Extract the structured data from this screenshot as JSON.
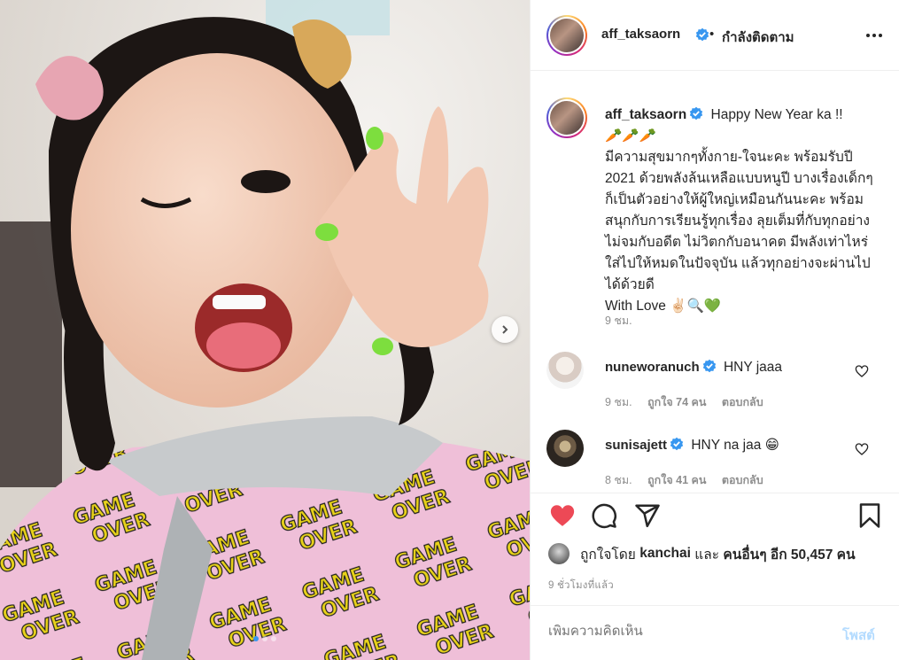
{
  "post": {
    "username": "aff_taksaorn",
    "separator": "•",
    "follow_label": "กำลังติดตาม",
    "caption_head": "Happy New Year ka !!",
    "caption_emoji_line": "🥕🥕🥕",
    "caption_body": "มีความสุขมากๆทั้งกาย-ใจนะคะ พร้อมรับปี 2021 ด้วยพลังล้นเหลือแบบหนูปี บางเรื่องเด็กๆก็เป็นตัวอย่างให้ผู้ใหญ่เหมือนกันนะคะ พร้อมสนุกกับการเรียนรู้ทุกเรื่อง ลุยเต็มที่กับทุกอย่าง ไม่จมกับอดีต ไม่วิตกกับอนาคต มีพลังเท่าไหร่ใส่ไปให้หมดในปัจจุบัน แล้วทุกอย่างจะผ่านไปได้ด้วยดี",
    "caption_tail": "With Love ✌🏻🔍💚",
    "caption_time": "9 ชม.",
    "carousel": {
      "count": 3,
      "active": 0
    }
  },
  "comments": [
    {
      "username": "nuneworanuch",
      "text": "HNY jaaa",
      "time": "9 ชม.",
      "likes": "ถูกใจ 74 คน",
      "reply": "ตอบกลับ"
    },
    {
      "username": "sunisajett",
      "text": "HNY na jaa 😁",
      "time": "8 ชม.",
      "likes": "ถูกใจ 41 คน",
      "reply": "ตอบกลับ"
    }
  ],
  "actions": {
    "liked_prefix": "ถูกใจโดย",
    "liked_user": "kanchai",
    "liked_and": "และ",
    "liked_others": "คนอื่นๆ อีก 50,457 คน",
    "ago": "9 ชั่วโมงที่แล้ว",
    "comment_placeholder": "เพิ่มความคิดเห็น",
    "post_label": "โพสต์"
  },
  "icons": {
    "verified": "verified-badge-icon",
    "more": "more-options-icon",
    "like": "heart-filled-icon",
    "comment": "comment-icon",
    "share": "share-icon",
    "save": "bookmark-icon",
    "next": "chevron-right-icon"
  },
  "colors": {
    "like_red": "#ed4956",
    "verified_blue": "#3897f0",
    "post_disabled": "#b3dbff"
  }
}
